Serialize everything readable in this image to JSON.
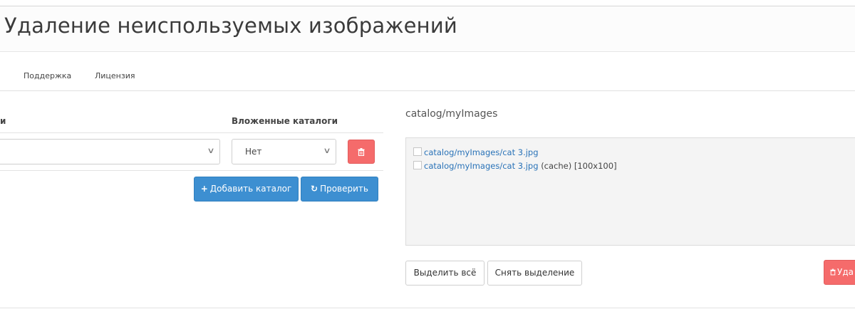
{
  "header": {
    "title": "Удаление неиспользуемых изображений"
  },
  "tabs": [
    {
      "label": "Поддержка"
    },
    {
      "label": "Лицензия"
    }
  ],
  "folders_table": {
    "left_header": "и",
    "nested_header": "Вложенные каталоги",
    "nested_value": "Нет"
  },
  "actions": {
    "add_label": "Добавить каталог",
    "check_label": "Проверить"
  },
  "results": {
    "path": "catalog/myImages",
    "files": [
      {
        "link": "catalog/myImages/cat 3.jpg",
        "note": ""
      },
      {
        "link": "catalog/myImages/cat 3.jpg",
        "note": "(cache) [100x100]"
      }
    ],
    "select_all_label": "Выделить всё",
    "deselect_label": "Снять выделение",
    "delete_label": "Уда"
  },
  "colors": {
    "primary": "#3d8fd1",
    "danger": "#f56b6b",
    "link": "#2a73b8"
  },
  "icons": {
    "trash": "trash-icon",
    "plus": "plus-icon",
    "refresh": "refresh-icon",
    "chevron": "chevron-down-icon"
  }
}
